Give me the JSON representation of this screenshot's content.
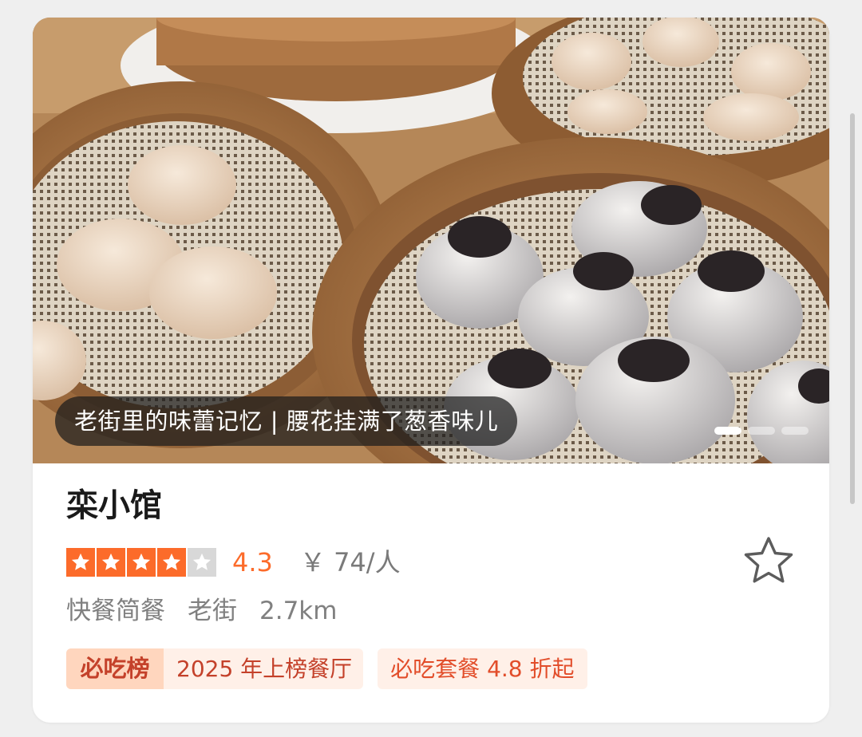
{
  "card": {
    "photo_caption": "老街里的味蕾记忆 | 腰花挂满了葱香味儿",
    "carousel": {
      "total": 3,
      "active_index": 0
    }
  },
  "restaurant": {
    "name": "栾小馆",
    "rating_value": "4.3",
    "stars_filled": 4,
    "stars_total": 5,
    "price": "￥ 74/人",
    "category": "快餐简餐",
    "area": "老街",
    "distance": "2.7km"
  },
  "tags": {
    "rank_logo": "必吃榜",
    "rank_text": "2025 年上榜餐厅",
    "deal_text": "必吃套餐 4.8 折起"
  },
  "icons": {
    "favorite": "star-outline-icon",
    "rating_star": "star-filled-icon"
  },
  "colors": {
    "accent": "#fc6b2a",
    "tag_bg": "#fff0e8",
    "tag_text": "#c4412a"
  }
}
